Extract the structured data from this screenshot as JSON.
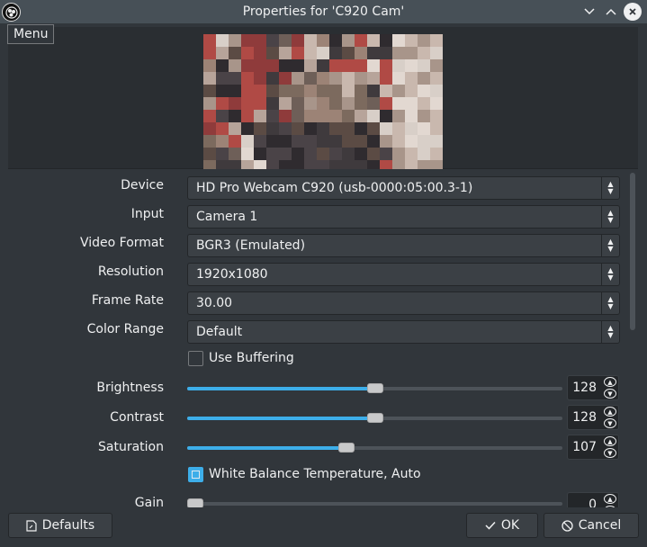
{
  "window": {
    "title": "Properties for 'C920 Cam'",
    "menu_tooltip": "Menu"
  },
  "properties": {
    "device": {
      "label": "Device",
      "value": "HD Pro Webcam C920 (usb-0000:05:00.3-1)"
    },
    "input": {
      "label": "Input",
      "value": "Camera 1"
    },
    "video_format": {
      "label": "Video Format",
      "value": "BGR3 (Emulated)"
    },
    "resolution": {
      "label": "Resolution",
      "value": "1920x1080"
    },
    "frame_rate": {
      "label": "Frame Rate",
      "value": "30.00"
    },
    "color_range": {
      "label": "Color Range",
      "value": "Default"
    },
    "use_buffering": {
      "label": "Use Buffering",
      "checked": false
    },
    "brightness": {
      "label": "Brightness",
      "value": "128",
      "level": 0.5
    },
    "contrast": {
      "label": "Contrast",
      "value": "128",
      "level": 0.5
    },
    "saturation": {
      "label": "Saturation",
      "value": "107",
      "level": 0.42
    },
    "white_balance_auto": {
      "label": "White Balance Temperature, Auto",
      "checked": true
    },
    "gain": {
      "label": "Gain",
      "value": "0",
      "level": 0.0
    }
  },
  "footer": {
    "defaults_label": "Defaults",
    "ok_label": "OK",
    "cancel_label": "Cancel"
  },
  "colors": {
    "accent": "#3daee9",
    "background": "#31363b",
    "titlebar": "#475057"
  }
}
